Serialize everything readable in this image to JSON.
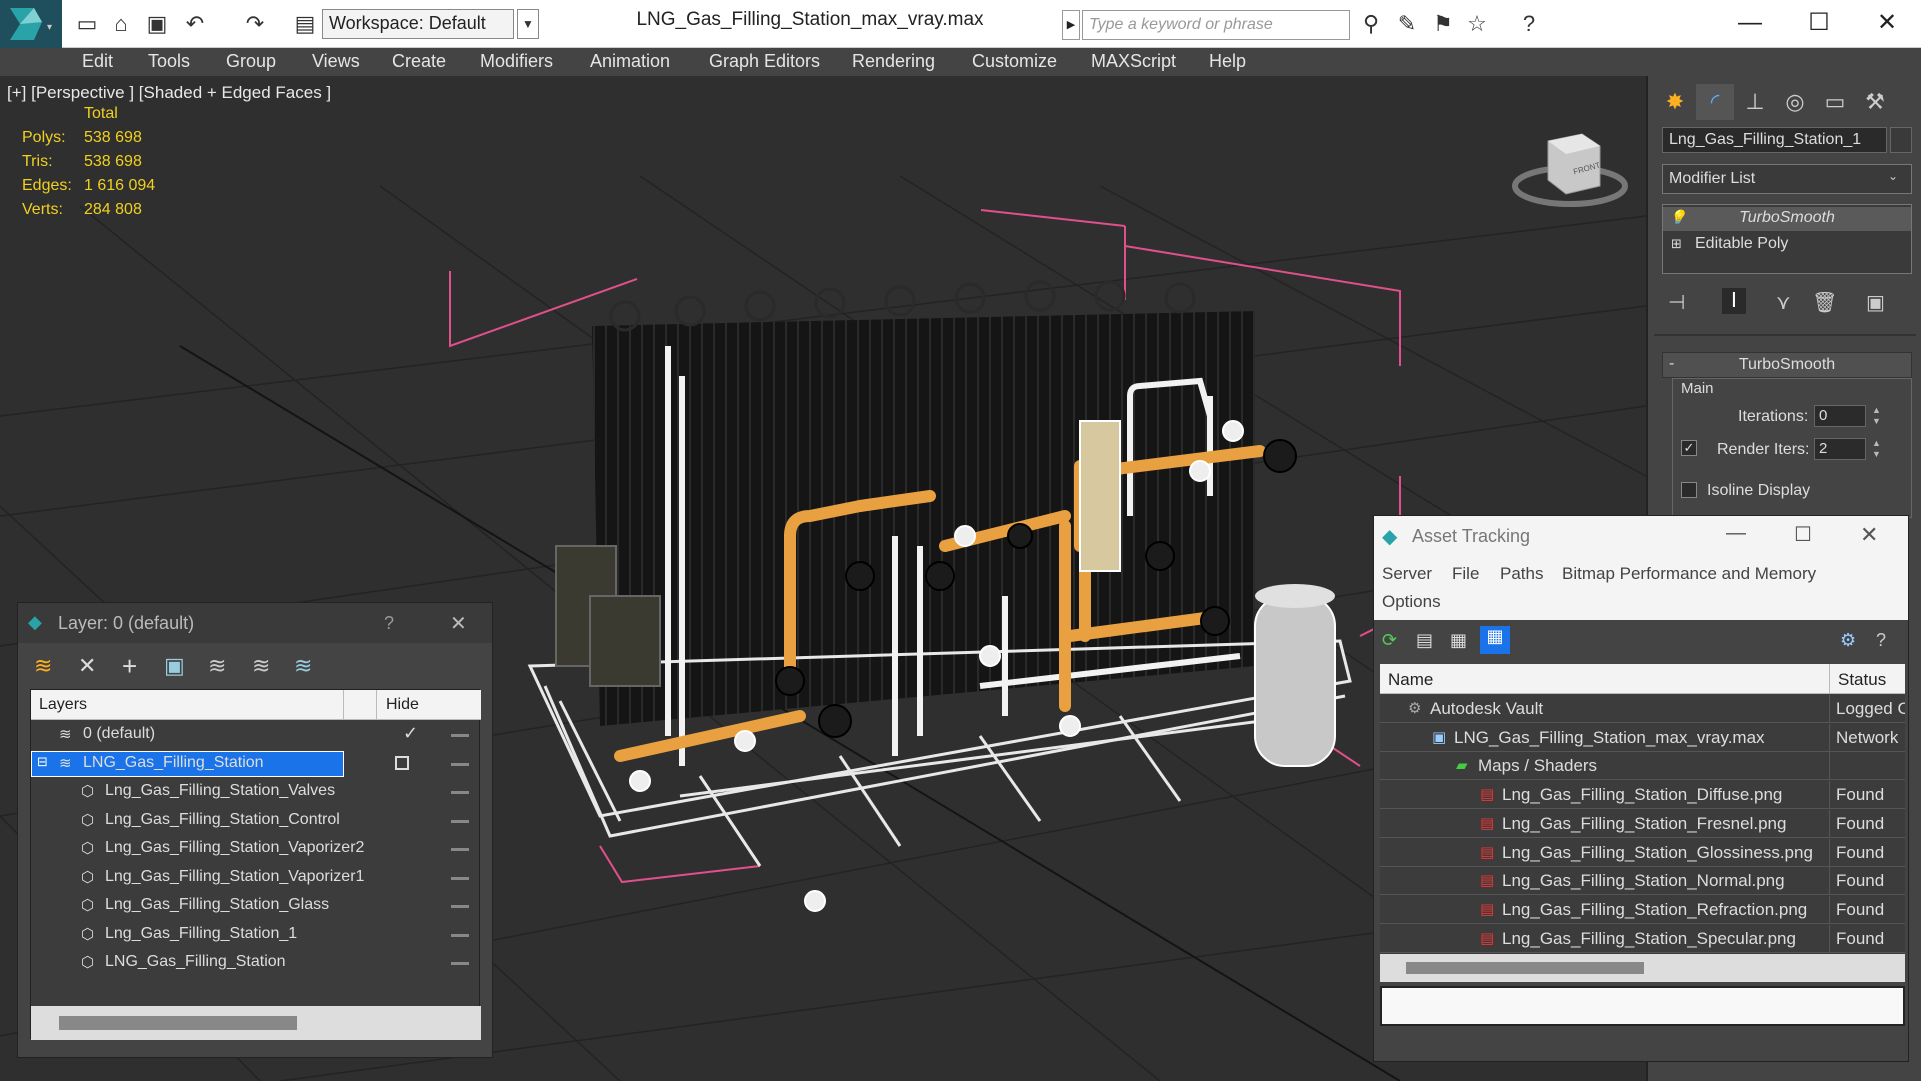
{
  "titlebar": {
    "workspace_label": "Workspace: Default",
    "document_title": "LNG_Gas_Filling_Station_max_vray.max",
    "search_placeholder": "Type a keyword or phrase"
  },
  "menubar": [
    "Edit",
    "Tools",
    "Group",
    "Views",
    "Create",
    "Modifiers",
    "Animation",
    "Graph Editors",
    "Rendering",
    "Customize",
    "MAXScript",
    "Help"
  ],
  "viewport": {
    "label": "[+] [Perspective ] [Shaded + Edged Faces ]",
    "stats": {
      "header": "Total",
      "polys_label": "Polys:",
      "polys": "538 698",
      "tris_label": "Tris:",
      "tris": "538 698",
      "edges_label": "Edges:",
      "edges": "1 616 094",
      "verts_label": "Verts:",
      "verts": "284 808"
    },
    "viewcube_text": "FRONT"
  },
  "command_panel": {
    "object_name": "Lng_Gas_Filling_Station_1",
    "modifier_list": "Modifier List",
    "stack": [
      "TurboSmooth",
      "Editable Poly"
    ],
    "rollout_title": "TurboSmooth",
    "group_main": "Main",
    "iterations_label": "Iterations:",
    "iterations_value": "0",
    "render_iters_label": "Render Iters:",
    "render_iters_value": "2",
    "isoline_label": "Isoline Display"
  },
  "layer_dialog": {
    "title": "Layer: 0 (default)",
    "help": "?",
    "col_layers": "Layers",
    "col_hide": "Hide",
    "rows": [
      {
        "name": "0 (default)",
        "indent": 0
      },
      {
        "name": "LNG_Gas_Filling_Station",
        "indent": 0,
        "selected": true
      },
      {
        "name": "Lng_Gas_Filling_Station_Valves",
        "indent": 1
      },
      {
        "name": "Lng_Gas_Filling_Station_Control",
        "indent": 1
      },
      {
        "name": "Lng_Gas_Filling_Station_Vaporizer2",
        "indent": 1
      },
      {
        "name": "Lng_Gas_Filling_Station_Vaporizer1",
        "indent": 1
      },
      {
        "name": "Lng_Gas_Filling_Station_Glass",
        "indent": 1
      },
      {
        "name": "Lng_Gas_Filling_Station_1",
        "indent": 1
      },
      {
        "name": "LNG_Gas_Filling_Station",
        "indent": 1
      }
    ]
  },
  "asset_dialog": {
    "title": "Asset Tracking",
    "menu": [
      "Server",
      "File",
      "Paths",
      "Bitmap Performance and Memory",
      "Options"
    ],
    "col_name": "Name",
    "col_status": "Status",
    "rows": [
      {
        "name": "Autodesk Vault",
        "status": "Logged C",
        "indent": 0,
        "icon": "vault-icon"
      },
      {
        "name": "LNG_Gas_Filling_Station_max_vray.max",
        "status": "Network",
        "indent": 1,
        "icon": "max-file-icon"
      },
      {
        "name": "Maps / Shaders",
        "status": "",
        "indent": 2,
        "icon": "maps-icon"
      },
      {
        "name": "Lng_Gas_Filling_Station_Diffuse.png",
        "status": "Found",
        "indent": 3,
        "icon": "png-icon"
      },
      {
        "name": "Lng_Gas_Filling_Station_Fresnel.png",
        "status": "Found",
        "indent": 3,
        "icon": "png-icon"
      },
      {
        "name": "Lng_Gas_Filling_Station_Glossiness.png",
        "status": "Found",
        "indent": 3,
        "icon": "png-icon"
      },
      {
        "name": "Lng_Gas_Filling_Station_Normal.png",
        "status": "Found",
        "indent": 3,
        "icon": "png-icon"
      },
      {
        "name": "Lng_Gas_Filling_Station_Refraction.png",
        "status": "Found",
        "indent": 3,
        "icon": "png-icon"
      },
      {
        "name": "Lng_Gas_Filling_Station_Specular.png",
        "status": "Found",
        "indent": 3,
        "icon": "png-icon"
      }
    ]
  },
  "colors": {
    "viewport_bg": "#2f2f2f",
    "stats_yellow": "#f0d020",
    "selection_blue": "#1a73e8",
    "bbox_pink": "#e0508a",
    "pipe_orange": "#e8a040"
  }
}
